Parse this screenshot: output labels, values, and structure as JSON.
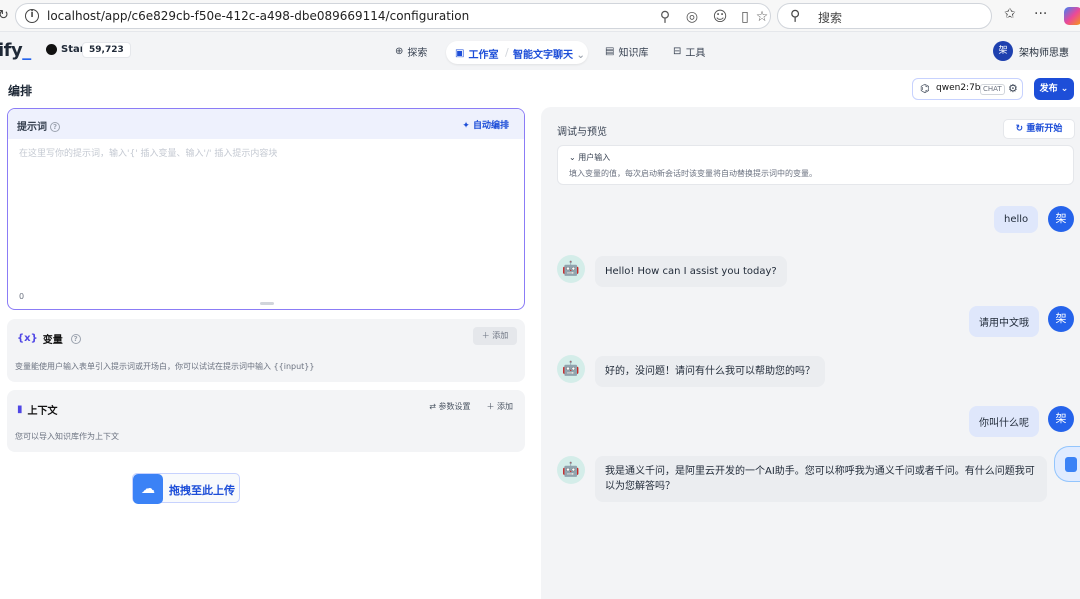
{
  "browser": {
    "url": "localhost/app/c6e829cb-f50e-412c-a498-dbe089669114/configuration",
    "search_placeholder": "搜索"
  },
  "header": {
    "logo_text": "ify",
    "github_label": "Star",
    "github_count": "59,723",
    "nav": {
      "explore": "探索",
      "studio": "工作室",
      "app_name": "智能文字聊天",
      "knowledge": "知识库",
      "tools": "工具"
    },
    "user_initial": "架",
    "user_name": "架构师思惠"
  },
  "editor": {
    "title": "编排",
    "model_name": "qwen2:7b",
    "model_tag": "CHAT",
    "publish_label": "发布",
    "prompt": {
      "label": "提示词",
      "auto_label": "自动编排",
      "placeholder": "在这里写你的提示词，输入'{' 插入变量、输入'/' 插入提示内容块",
      "count": "0"
    },
    "variables": {
      "title": "变量",
      "add_label": "添加",
      "description": "变量能使用户输入表单引入提示词或开场白，你可以试试在提示词中输入 {{input}}"
    },
    "context": {
      "title": "上下文",
      "params_label": "参数设置",
      "add_label": "添加",
      "description": "您可以导入知识库作为上下文"
    },
    "upload_label": "拖拽至此上传"
  },
  "preview": {
    "title": "调试与预览",
    "restart_label": "重新开始",
    "user_input_title": "用户输入",
    "user_input_desc": "填入变量的值，每次启动新会话时该变量将自动替换提示词中的变量。",
    "messages": [
      {
        "role": "user",
        "text": "hello"
      },
      {
        "role": "bot",
        "text": "Hello! How can I assist you today?"
      },
      {
        "role": "user",
        "text": "请用中文哦"
      },
      {
        "role": "bot",
        "text": "好的，没问题！请问有什么我可以帮助您的吗？"
      },
      {
        "role": "user",
        "text": "你叫什么呢"
      },
      {
        "role": "bot",
        "text": "我是通义千问，是阿里云开发的一个AI助手。您可以称呼我为通义千问或者千问。有什么问题我可以为您解答吗？"
      }
    ]
  },
  "colors": {
    "accent": "#1d4ed8",
    "prompt_border": "#8b7cf6",
    "user_bubble": "#dfe7fb",
    "bot_bubble": "#ebedf0"
  }
}
